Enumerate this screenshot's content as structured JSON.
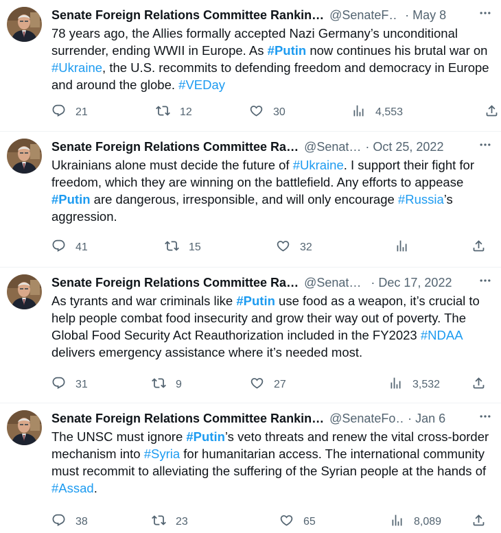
{
  "tweets": [
    {
      "name": "Senate Foreign Relations Committee Rankin…",
      "handle": "@SenateF…",
      "time": "· May 8",
      "segments": [
        {
          "t": "78 years ago, the Allies formally accepted Nazi Germany’s unconditional surrender, ending WWII in Europe. As "
        },
        {
          "t": "#Putin",
          "tag": true,
          "bold": true
        },
        {
          "t": " now continues his brutal war on "
        },
        {
          "t": "#Ukraine",
          "tag": true
        },
        {
          "t": ", the U.S. recommits to defending freedom and democracy in Europe and around the globe. "
        },
        {
          "t": "#VEDay",
          "tag": true
        }
      ],
      "replies": "21",
      "retweets": "12",
      "likes": "30",
      "views": "4,553"
    },
    {
      "name": "Senate Foreign Relations Committee Ra…",
      "handle": "@Senat…",
      "time": "· Oct 25, 2022",
      "segments": [
        {
          "t": "Ukrainians alone must decide the future of "
        },
        {
          "t": "#Ukraine",
          "tag": true
        },
        {
          "t": ". I support their fight for freedom, which they are winning on the battlefield. Any efforts to appease "
        },
        {
          "t": "#Putin",
          "tag": true,
          "bold": true
        },
        {
          "t": " are dangerous, irresponsible, and will only encourage "
        },
        {
          "t": "#Russia",
          "tag": true
        },
        {
          "t": "’s aggression."
        }
      ],
      "replies": "41",
      "retweets": "15",
      "likes": "32",
      "views": ""
    },
    {
      "name": "Senate Foreign Relations Committee Ra…",
      "handle": "@Senat…",
      "time": "· Dec 17, 2022",
      "segments": [
        {
          "t": "As tyrants and war criminals like "
        },
        {
          "t": "#Putin",
          "tag": true,
          "bold": true
        },
        {
          "t": " use food as a weapon, it’s crucial to help people combat food insecurity and grow their way out of poverty. The Global Food Security Act Reauthorization included in the FY2023 "
        },
        {
          "t": "#NDAA",
          "tag": true
        },
        {
          "t": " delivers emergency assistance where it’s needed most."
        }
      ],
      "replies": "31",
      "retweets": "9",
      "likes": "27",
      "views": "3,532"
    },
    {
      "name": "Senate Foreign Relations Committee Rankin…",
      "handle": "@SenateFo…",
      "time": "· Jan 6",
      "segments": [
        {
          "t": "The UNSC must ignore "
        },
        {
          "t": "#Putin",
          "tag": true,
          "bold": true
        },
        {
          "t": "’s veto threats and renew the vital cross-border mechanism into "
        },
        {
          "t": "#Syria",
          "tag": true
        },
        {
          "t": " for humanitarian access. The international community must recommit to alleviating the suffering of the Syrian people at the hands of "
        },
        {
          "t": "#Assad",
          "tag": true
        },
        {
          "t": "."
        }
      ],
      "replies": "38",
      "retweets": "23",
      "likes": "65",
      "views": "8,089"
    }
  ],
  "colors": {
    "text": "#0f1419",
    "muted": "#536471",
    "hashtag": "#1d9bf0",
    "divider": "#eff3f4"
  }
}
